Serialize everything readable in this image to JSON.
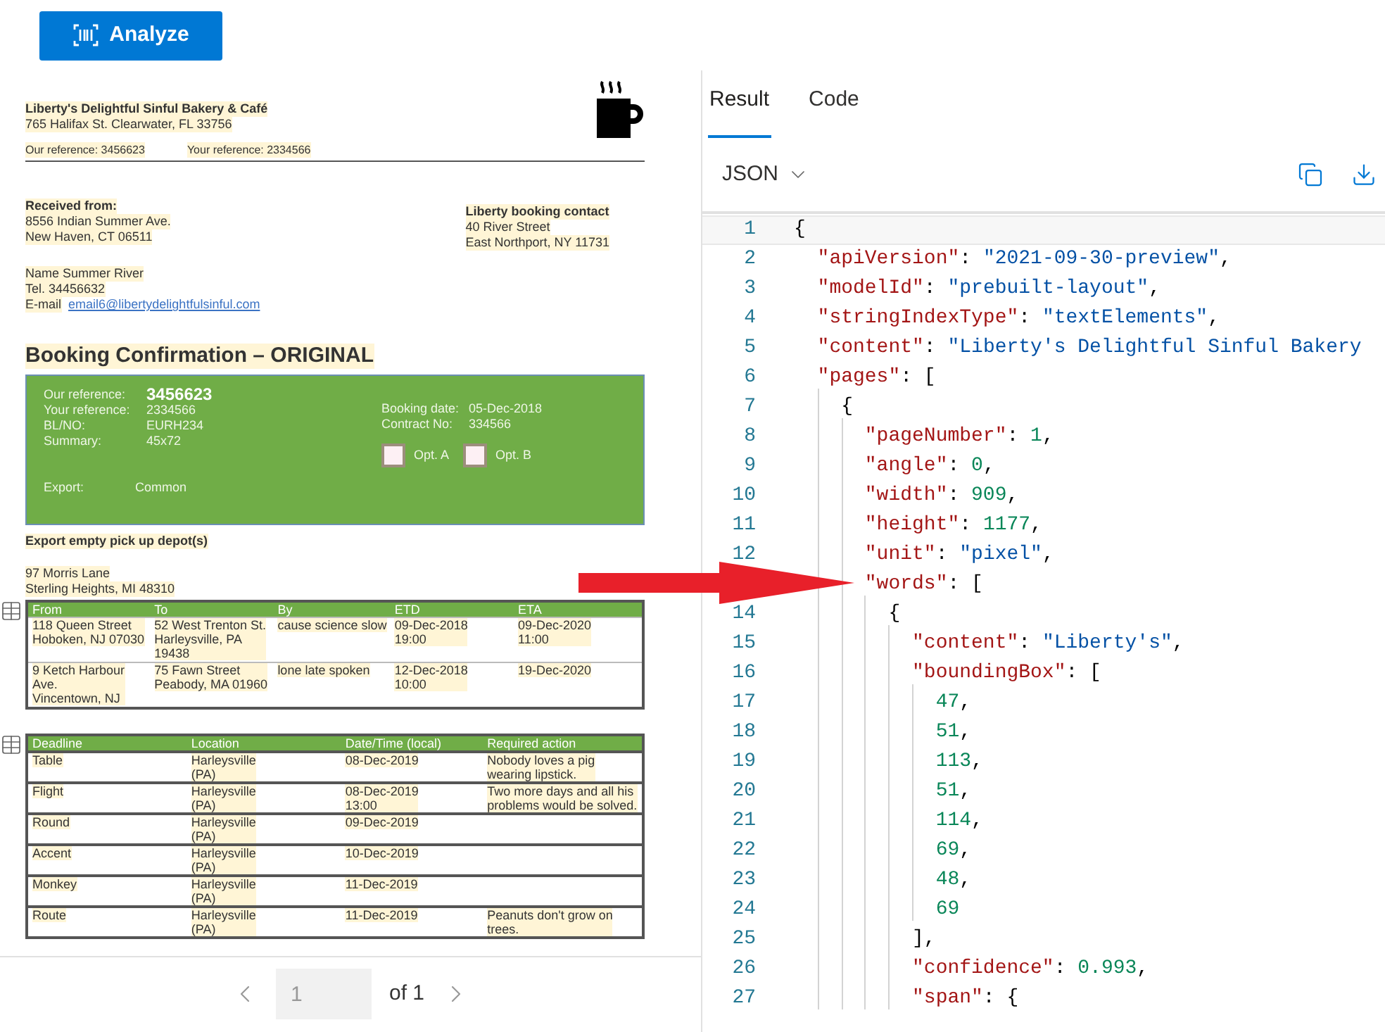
{
  "toolbar": {
    "analyze_button": "Analyze"
  },
  "document": {
    "company": "Liberty's Delightful Sinful Bakery & Café",
    "address": "765 Halifax St. Clearwater, FL 33756",
    "our_reference": "Our reference: 3456623",
    "your_reference": "Your reference: 2334566",
    "received_from": {
      "heading": "Received from:",
      "lines": [
        "8556 Indian Summer Ave.",
        "New Haven, CT 06511"
      ]
    },
    "contact": {
      "heading": "Liberty booking contact",
      "lines": [
        "40 River Street",
        "East Northport, NY 11731"
      ]
    },
    "person": [
      "Name Summer River",
      "Tel. 34456632"
    ],
    "email_label": "E-mail",
    "email": "email6@libertydelightfulsinful.com",
    "title": "Booking Confirmation – ORIGINAL",
    "summary_box": {
      "left_fields": [
        {
          "label": "Our reference:",
          "value": "3456623",
          "emphasis": true
        },
        {
          "label": "Your reference:",
          "value": "2334566",
          "emphasis": false
        },
        {
          "label": "BL/NO:",
          "value": "EURH234",
          "emphasis": false
        },
        {
          "label": "Summary:",
          "value": "45x72",
          "emphasis": false
        }
      ],
      "right_fields": [
        {
          "label": "Booking date:",
          "value": "05-Dec-2018"
        },
        {
          "label": "Contract No:",
          "value": "334566"
        }
      ],
      "options": [
        {
          "label": "Opt. A",
          "checked": false
        },
        {
          "label": "Opt. B",
          "checked": false
        }
      ],
      "export": {
        "label": "Export:",
        "value": "Common"
      }
    },
    "depot": {
      "heading": "Export empty pick up depot(s)",
      "lines": [
        "97 Morris Lane",
        "Sterling Heights, MI 48310"
      ]
    },
    "tables": [
      {
        "columns": [
          "From",
          "To",
          "By",
          "ETD",
          "ETA"
        ],
        "rows": [
          [
            "118 Queen Street\nHoboken, NJ 07030",
            "52 West Trenton St.\nHarleysville, PA\n19438",
            "cause science slow",
            "09-Dec-2018\n19:00",
            "09-Dec-2020\n11:00"
          ],
          [
            "9 Ketch Harbour\nAve.\nVincentown, NJ",
            "75 Fawn Street\nPeabody, MA 01960",
            "lone late spoken",
            "12-Dec-2018\n10:00",
            "19-Dec-2020"
          ]
        ]
      },
      {
        "columns": [
          "Deadline",
          "Location",
          "Date/Time (local)",
          "Required action"
        ],
        "rows": [
          [
            "Table",
            "Harleysville\n(PA)",
            "08-Dec-2019",
            "Nobody loves a pig\nwearing lipstick."
          ],
          [
            "Flight",
            "Harleysville\n(PA)",
            "08-Dec-2019\n13:00",
            "Two more days and all his\nproblems would be solved."
          ],
          [
            "Round",
            "Harleysville\n(PA)",
            "09-Dec-2019",
            ""
          ],
          [
            "Accent",
            "Harleysville\n(PA)",
            "10-Dec-2019",
            ""
          ],
          [
            "Monkey",
            "Harleysville\n(PA)",
            "11-Dec-2019",
            ""
          ],
          [
            "Route",
            "Harleysville\n(PA)",
            "11-Dec-2019",
            "Peanuts don't grow on\ntrees."
          ]
        ]
      }
    ]
  },
  "pager": {
    "page": "1",
    "of": "of 1"
  },
  "result_panel": {
    "tabs": [
      {
        "label": "Result",
        "selected": true
      },
      {
        "label": "Code",
        "selected": false
      }
    ],
    "format": "JSON",
    "code_lines": [
      {
        "number": "1",
        "tokens": [
          {
            "kind": "punct",
            "text": "{"
          }
        ]
      },
      {
        "number": "2",
        "tokens": [
          {
            "kind": "key",
            "text": "  \"apiVersion\""
          },
          {
            "kind": "punct",
            "text": ": "
          },
          {
            "kind": "string",
            "text": "\"2021-09-30-preview\""
          },
          {
            "kind": "punct",
            "text": ","
          }
        ]
      },
      {
        "number": "3",
        "tokens": [
          {
            "kind": "key",
            "text": "  \"modelId\""
          },
          {
            "kind": "punct",
            "text": ": "
          },
          {
            "kind": "string",
            "text": "\"prebuilt-layout\""
          },
          {
            "kind": "punct",
            "text": ","
          }
        ]
      },
      {
        "number": "4",
        "tokens": [
          {
            "kind": "key",
            "text": "  \"stringIndexType\""
          },
          {
            "kind": "punct",
            "text": ": "
          },
          {
            "kind": "string",
            "text": "\"textElements\""
          },
          {
            "kind": "punct",
            "text": ","
          }
        ]
      },
      {
        "number": "5",
        "tokens": [
          {
            "kind": "key",
            "text": "  \"content\""
          },
          {
            "kind": "punct",
            "text": ": "
          },
          {
            "kind": "string",
            "text": "\"Liberty's Delightful Sinful Bakery"
          }
        ]
      },
      {
        "number": "6",
        "tokens": [
          {
            "kind": "key",
            "text": "  \"pages\""
          },
          {
            "kind": "punct",
            "text": ": ["
          }
        ]
      },
      {
        "number": "7",
        "tokens": [
          {
            "kind": "punct",
            "text": "    {"
          }
        ]
      },
      {
        "number": "8",
        "tokens": [
          {
            "kind": "key",
            "text": "      \"pageNumber\""
          },
          {
            "kind": "punct",
            "text": ": "
          },
          {
            "kind": "number",
            "text": "1"
          },
          {
            "kind": "punct",
            "text": ","
          }
        ]
      },
      {
        "number": "9",
        "tokens": [
          {
            "kind": "key",
            "text": "      \"angle\""
          },
          {
            "kind": "punct",
            "text": ": "
          },
          {
            "kind": "number",
            "text": "0"
          },
          {
            "kind": "punct",
            "text": ","
          }
        ]
      },
      {
        "number": "10",
        "tokens": [
          {
            "kind": "key",
            "text": "      \"width\""
          },
          {
            "kind": "punct",
            "text": ": "
          },
          {
            "kind": "number",
            "text": "909"
          },
          {
            "kind": "punct",
            "text": ","
          }
        ]
      },
      {
        "number": "11",
        "tokens": [
          {
            "kind": "key",
            "text": "      \"height\""
          },
          {
            "kind": "punct",
            "text": ": "
          },
          {
            "kind": "number",
            "text": "1177"
          },
          {
            "kind": "punct",
            "text": ","
          }
        ]
      },
      {
        "number": "12",
        "tokens": [
          {
            "kind": "key",
            "text": "      \"unit\""
          },
          {
            "kind": "punct",
            "text": ": "
          },
          {
            "kind": "string",
            "text": "\"pixel\""
          },
          {
            "kind": "punct",
            "text": ","
          }
        ]
      },
      {
        "tokens": [
          {
            "kind": "key",
            "text": "      \"words\""
          },
          {
            "kind": "punct",
            "text": ": ["
          }
        ]
      },
      {
        "number": "14",
        "tokens": [
          {
            "kind": "punct",
            "text": "        {"
          }
        ]
      },
      {
        "number": "15",
        "tokens": [
          {
            "kind": "key",
            "text": "          \"content\""
          },
          {
            "kind": "punct",
            "text": ": "
          },
          {
            "kind": "string",
            "text": "\"Liberty's\""
          },
          {
            "kind": "punct",
            "text": ","
          }
        ]
      },
      {
        "number": "16",
        "tokens": [
          {
            "kind": "key",
            "text": "          \"boundingBox\""
          },
          {
            "kind": "punct",
            "text": ": ["
          }
        ]
      },
      {
        "number": "17",
        "tokens": [
          {
            "kind": "number",
            "text": "            47"
          },
          {
            "kind": "punct",
            "text": ","
          }
        ]
      },
      {
        "number": "18",
        "tokens": [
          {
            "kind": "number",
            "text": "            51"
          },
          {
            "kind": "punct",
            "text": ","
          }
        ]
      },
      {
        "number": "19",
        "tokens": [
          {
            "kind": "number",
            "text": "            113"
          },
          {
            "kind": "punct",
            "text": ","
          }
        ]
      },
      {
        "number": "20",
        "tokens": [
          {
            "kind": "number",
            "text": "            51"
          },
          {
            "kind": "punct",
            "text": ","
          }
        ]
      },
      {
        "number": "21",
        "tokens": [
          {
            "kind": "number",
            "text": "            114"
          },
          {
            "kind": "punct",
            "text": ","
          }
        ]
      },
      {
        "number": "22",
        "tokens": [
          {
            "kind": "number",
            "text": "            69"
          },
          {
            "kind": "punct",
            "text": ","
          }
        ]
      },
      {
        "number": "23",
        "tokens": [
          {
            "kind": "number",
            "text": "            48"
          },
          {
            "kind": "punct",
            "text": ","
          }
        ]
      },
      {
        "number": "24",
        "tokens": [
          {
            "kind": "number",
            "text": "            69"
          }
        ]
      },
      {
        "number": "25",
        "tokens": [
          {
            "kind": "punct",
            "text": "          ],"
          }
        ]
      },
      {
        "number": "26",
        "tokens": [
          {
            "kind": "key",
            "text": "          \"confidence\""
          },
          {
            "kind": "punct",
            "text": ": "
          },
          {
            "kind": "number",
            "text": "0.993"
          },
          {
            "kind": "punct",
            "text": ","
          }
        ]
      },
      {
        "number": "27",
        "tokens": [
          {
            "kind": "key",
            "text": "          \"span\""
          },
          {
            "kind": "punct",
            "text": ": {"
          }
        ]
      }
    ]
  }
}
